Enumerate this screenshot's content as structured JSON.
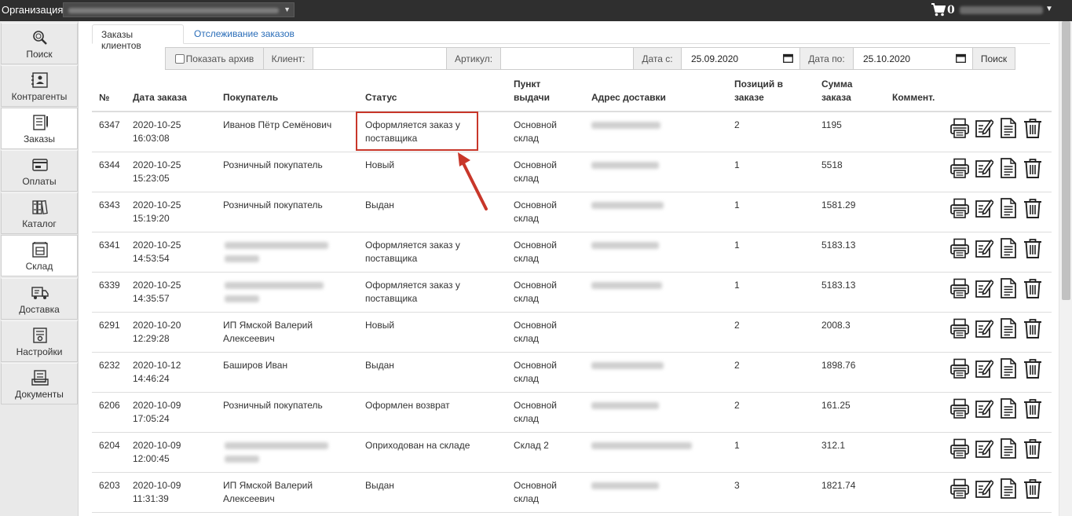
{
  "topbar": {
    "org_label": "Организация:",
    "cart_count": "0",
    "accent_color": "#2f2f2f"
  },
  "sidebar": {
    "items": [
      {
        "label": "Поиск",
        "icon": "search-icon",
        "active": false
      },
      {
        "label": "Контрагенты",
        "icon": "contacts-icon",
        "active": false
      },
      {
        "label": "Заказы",
        "icon": "orders-icon",
        "active": true
      },
      {
        "label": "Оплаты",
        "icon": "payments-icon",
        "active": false
      },
      {
        "label": "Каталог",
        "icon": "catalog-icon",
        "active": false
      },
      {
        "label": "Склад",
        "icon": "warehouse-icon",
        "active": true
      },
      {
        "label": "Доставка",
        "icon": "delivery-icon",
        "active": false
      },
      {
        "label": "Настройки",
        "icon": "settings-icon",
        "active": false
      },
      {
        "label": "Документы",
        "icon": "documents-icon",
        "active": false
      }
    ]
  },
  "tabs": [
    {
      "label": "Заказы клиентов",
      "active": true
    },
    {
      "label": "Отслеживание заказов",
      "active": false
    }
  ],
  "filter": {
    "archive_label": "Показать архив",
    "client_label": "Клиент:",
    "client_value": "",
    "article_label": "Артикул:",
    "article_value": "",
    "date_from_label": "Дата с:",
    "date_from": "25.09.2020",
    "date_to_label": "Дата по:",
    "date_to": "25.10.2020",
    "search_label": "Поиск"
  },
  "table": {
    "headers": {
      "num": "№",
      "date": "Дата заказа",
      "buyer": "Покупатель",
      "status": "Статус",
      "pickup_1": "Пункт",
      "pickup_2": "выдачи",
      "address": "Адрес доставки",
      "positions_1": "Позиций в",
      "positions_2": "заказе",
      "sum_1": "Сумма",
      "sum_2": "заказа",
      "comment": "Коммент."
    },
    "rows": [
      {
        "num": "6347",
        "date": "2020-10-25",
        "time": "16:03:08",
        "buyer_1": "Иванов Пётр Семёнович",
        "buyer_2": "",
        "buyer_blurred": false,
        "status_1": "Оформляется заказ у",
        "status_2": "поставщика",
        "pickup_1": "Основной",
        "pickup_2": "склад",
        "positions": "2",
        "sum": "1195"
      },
      {
        "num": "6344",
        "date": "2020-10-25",
        "time": "15:23:05",
        "buyer_1": "Розничный покупатель",
        "buyer_2": "",
        "buyer_blurred": false,
        "status_1": "Новый",
        "status_2": "",
        "pickup_1": "Основной",
        "pickup_2": "склад",
        "positions": "1",
        "sum": "5518"
      },
      {
        "num": "6343",
        "date": "2020-10-25",
        "time": "15:19:20",
        "buyer_1": "Розничный покупатель",
        "buyer_2": "",
        "buyer_blurred": false,
        "status_1": "Выдан",
        "status_2": "",
        "pickup_1": "Основной",
        "pickup_2": "склад",
        "positions": "1",
        "sum": "1581.29"
      },
      {
        "num": "6341",
        "date": "2020-10-25",
        "time": "14:53:54",
        "buyer_1": "",
        "buyer_2": "",
        "buyer_blurred": true,
        "status_1": "Оформляется заказ у",
        "status_2": "поставщика",
        "pickup_1": "Основной",
        "pickup_2": "склад",
        "positions": "1",
        "sum": "5183.13"
      },
      {
        "num": "6339",
        "date": "2020-10-25",
        "time": "14:35:57",
        "buyer_1": "",
        "buyer_2": "",
        "buyer_blurred": true,
        "status_1": "Оформляется заказ у",
        "status_2": "поставщика",
        "pickup_1": "Основной",
        "pickup_2": "склад",
        "positions": "1",
        "sum": "5183.13"
      },
      {
        "num": "6291",
        "date": "2020-10-20",
        "time": "12:29:28",
        "buyer_1": "ИП Ямской Валерий",
        "buyer_2": "Алексеевич",
        "buyer_blurred": false,
        "status_1": "Новый",
        "status_2": "",
        "pickup_1": "Основной",
        "pickup_2": "склад",
        "positions": "2",
        "sum": "2008.3"
      },
      {
        "num": "6232",
        "date": "2020-10-12",
        "time": "14:46:24",
        "buyer_1": "Баширов Иван",
        "buyer_2": "",
        "buyer_blurred": false,
        "status_1": "Выдан",
        "status_2": "",
        "pickup_1": "Основной",
        "pickup_2": "склад",
        "positions": "2",
        "sum": "1898.76"
      },
      {
        "num": "6206",
        "date": "2020-10-09",
        "time": "17:05:24",
        "buyer_1": "Розничный покупатель",
        "buyer_2": "",
        "buyer_blurred": false,
        "status_1": "Оформлен возврат",
        "status_2": "",
        "pickup_1": "Основной",
        "pickup_2": "склад",
        "positions": "2",
        "sum": "161.25"
      },
      {
        "num": "6204",
        "date": "2020-10-09",
        "time": "12:00:45",
        "buyer_1": "",
        "buyer_2": "",
        "buyer_blurred": true,
        "status_1": "Оприходован на складе",
        "status_2": "",
        "pickup_1": "Склад 2",
        "pickup_2": "",
        "positions": "1",
        "sum": "312.1"
      },
      {
        "num": "6203",
        "date": "2020-10-09",
        "time": "11:31:39",
        "buyer_1": "ИП Ямской Валерий",
        "buyer_2": "Алексеевич",
        "buyer_blurred": false,
        "status_1": "Выдан",
        "status_2": "",
        "pickup_1": "Основной",
        "pickup_2": "склад",
        "positions": "3",
        "sum": "1821.74"
      }
    ],
    "row_actions": [
      "print-icon",
      "edit-icon",
      "document-icon",
      "trash-icon"
    ]
  },
  "annotation_color": "#c8372a"
}
